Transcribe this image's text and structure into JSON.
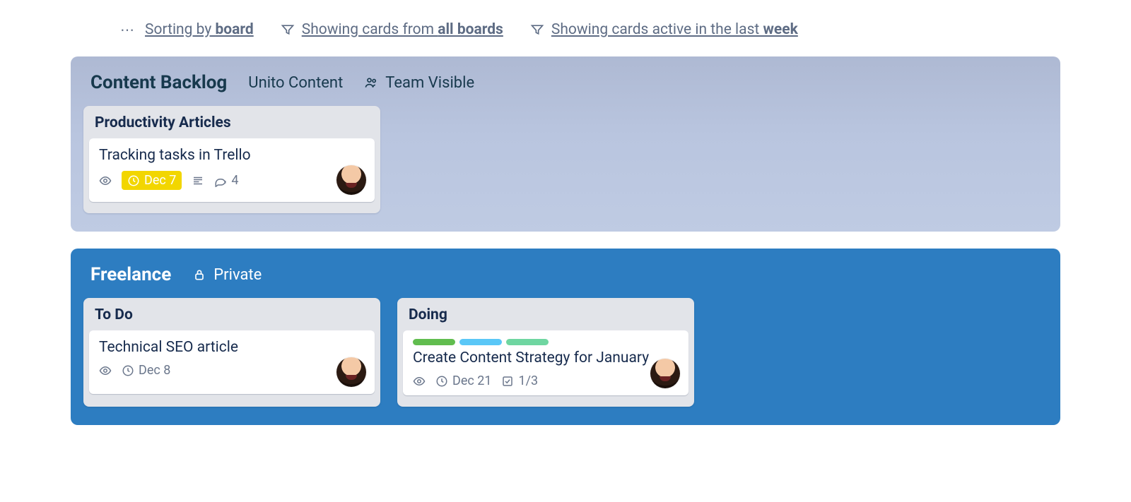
{
  "filters": {
    "sort": {
      "prefix": "Sorting by ",
      "strong": "board"
    },
    "scope": {
      "prefix": "Showing cards from ",
      "strong": "all boards"
    },
    "time": {
      "prefix": "Showing cards active in the last ",
      "strong": "week"
    }
  },
  "boards": [
    {
      "title": "Content Backlog",
      "team": "Unito Content",
      "visibility": "Team Visible",
      "lists": [
        {
          "title": "Productivity Articles",
          "cards": [
            {
              "title": "Tracking tasks in Trello",
              "due": "Dec 7",
              "dueColor": "yellow",
              "hasDescription": true,
              "comments": "4"
            }
          ]
        }
      ]
    },
    {
      "title": "Freelance",
      "visibility": "Private",
      "lists": [
        {
          "title": "To Do",
          "cards": [
            {
              "title": "Technical SEO article",
              "due": "Dec 8"
            }
          ]
        },
        {
          "title": "Doing",
          "cards": [
            {
              "title": "Create Content Strategy for January",
              "labels": [
                "green",
                "sky",
                "mint"
              ],
              "due": "Dec 21",
              "checklist": "1/3"
            }
          ]
        }
      ]
    }
  ]
}
